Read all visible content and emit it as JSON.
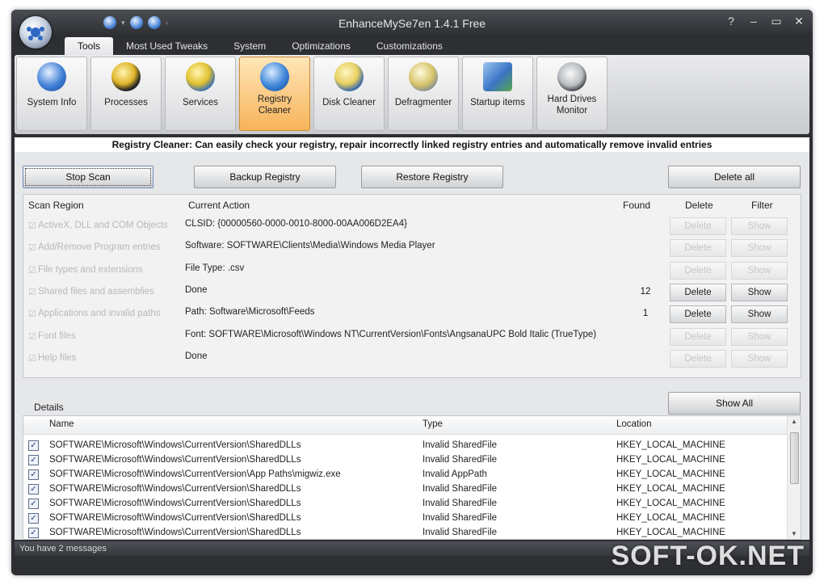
{
  "window": {
    "title": "EnhanceMySe7en  1.4.1 Free",
    "buttons": [
      "?",
      "–",
      "▭",
      "✕"
    ]
  },
  "tabs": [
    "Tools",
    "Most Used Tweaks",
    "System",
    "Optimizations",
    "Customizations"
  ],
  "ribbon": [
    {
      "label": "System Info",
      "icon": "monitor-info-icon"
    },
    {
      "label": "Processes",
      "icon": "gears-icon"
    },
    {
      "label": "Services",
      "icon": "service-gear-icon"
    },
    {
      "label": "Registry Cleaner",
      "icon": "globe-cleaner-icon"
    },
    {
      "label": "Disk Cleaner",
      "icon": "disk-cleaner-icon"
    },
    {
      "label": "Defragmenter",
      "icon": "defrag-icon"
    },
    {
      "label": "Startup items",
      "icon": "startup-icon"
    },
    {
      "label": "Hard Drives Monitor",
      "icon": "hard-drive-icon"
    }
  ],
  "banner": "Registry Cleaner: Can easily check your registry, repair incorrectly linked registry entries and automatically remove invalid entries",
  "actions": {
    "stop_scan": "Stop Scan",
    "backup": "Backup Registry",
    "restore": "Restore Registry",
    "delete_all": "Delete all"
  },
  "scan": {
    "headers": {
      "region": "Scan Region",
      "action": "Current Action",
      "found": "Found",
      "delete": "Delete",
      "filter": "Filter"
    },
    "rows": [
      {
        "region": "ActiveX, DLL and COM Objects",
        "action": "CLSID: {00000560-0000-0010-8000-00AA006D2EA4}",
        "found": "",
        "delete": "Delete",
        "show": "Show",
        "enabled": false
      },
      {
        "region": "Add/Remove Program entries",
        "action": "Software: SOFTWARE\\Clients\\Media\\Windows Media Player",
        "found": "",
        "delete": "Delete",
        "show": "Show",
        "enabled": false
      },
      {
        "region": "File types and extensions",
        "action": "File Type: .csv",
        "found": "",
        "delete": "Delete",
        "show": "Show",
        "enabled": false
      },
      {
        "region": "Shared files and assemblies",
        "action": "Done",
        "found": "12",
        "delete": "Delete",
        "show": "Show",
        "enabled": true
      },
      {
        "region": "Applications and invalid paths",
        "action": "Path: Software\\Microsoft\\Feeds",
        "found": "1",
        "delete": "Delete",
        "show": "Show",
        "enabled": true
      },
      {
        "region": "Font files",
        "action": "Font: SOFTWARE\\Microsoft\\Windows NT\\CurrentVersion\\Fonts\\AngsanaUPC Bold Italic (TrueType)",
        "found": "",
        "delete": "Delete",
        "show": "Show",
        "enabled": false
      },
      {
        "region": "Help files",
        "action": "Done",
        "found": "",
        "delete": "Delete",
        "show": "Show",
        "enabled": false
      }
    ]
  },
  "details": {
    "label": "Details",
    "show_all": "Show All",
    "headers": {
      "name": "Name",
      "type": "Type",
      "location": "Location"
    },
    "rows": [
      {
        "name": "SOFTWARE\\Microsoft\\Windows\\CurrentVersion\\SharedDLLs",
        "type": "Invalid SharedFile",
        "location": "HKEY_LOCAL_MACHINE"
      },
      {
        "name": "SOFTWARE\\Microsoft\\Windows\\CurrentVersion\\SharedDLLs",
        "type": "Invalid SharedFile",
        "location": "HKEY_LOCAL_MACHINE"
      },
      {
        "name": "SOFTWARE\\Microsoft\\Windows\\CurrentVersion\\App Paths\\migwiz.exe",
        "type": "Invalid AppPath",
        "location": "HKEY_LOCAL_MACHINE"
      },
      {
        "name": "SOFTWARE\\Microsoft\\Windows\\CurrentVersion\\SharedDLLs",
        "type": "Invalid SharedFile",
        "location": "HKEY_LOCAL_MACHINE"
      },
      {
        "name": "SOFTWARE\\Microsoft\\Windows\\CurrentVersion\\SharedDLLs",
        "type": "Invalid SharedFile",
        "location": "HKEY_LOCAL_MACHINE"
      },
      {
        "name": "SOFTWARE\\Microsoft\\Windows\\CurrentVersion\\SharedDLLs",
        "type": "Invalid SharedFile",
        "location": "HKEY_LOCAL_MACHINE"
      },
      {
        "name": "SOFTWARE\\Microsoft\\Windows\\CurrentVersion\\SharedDLLs",
        "type": "Invalid SharedFile",
        "location": "HKEY_LOCAL_MACHINE"
      }
    ]
  },
  "status": "You have 2 messages",
  "watermark": "SOFT-OK.NET"
}
